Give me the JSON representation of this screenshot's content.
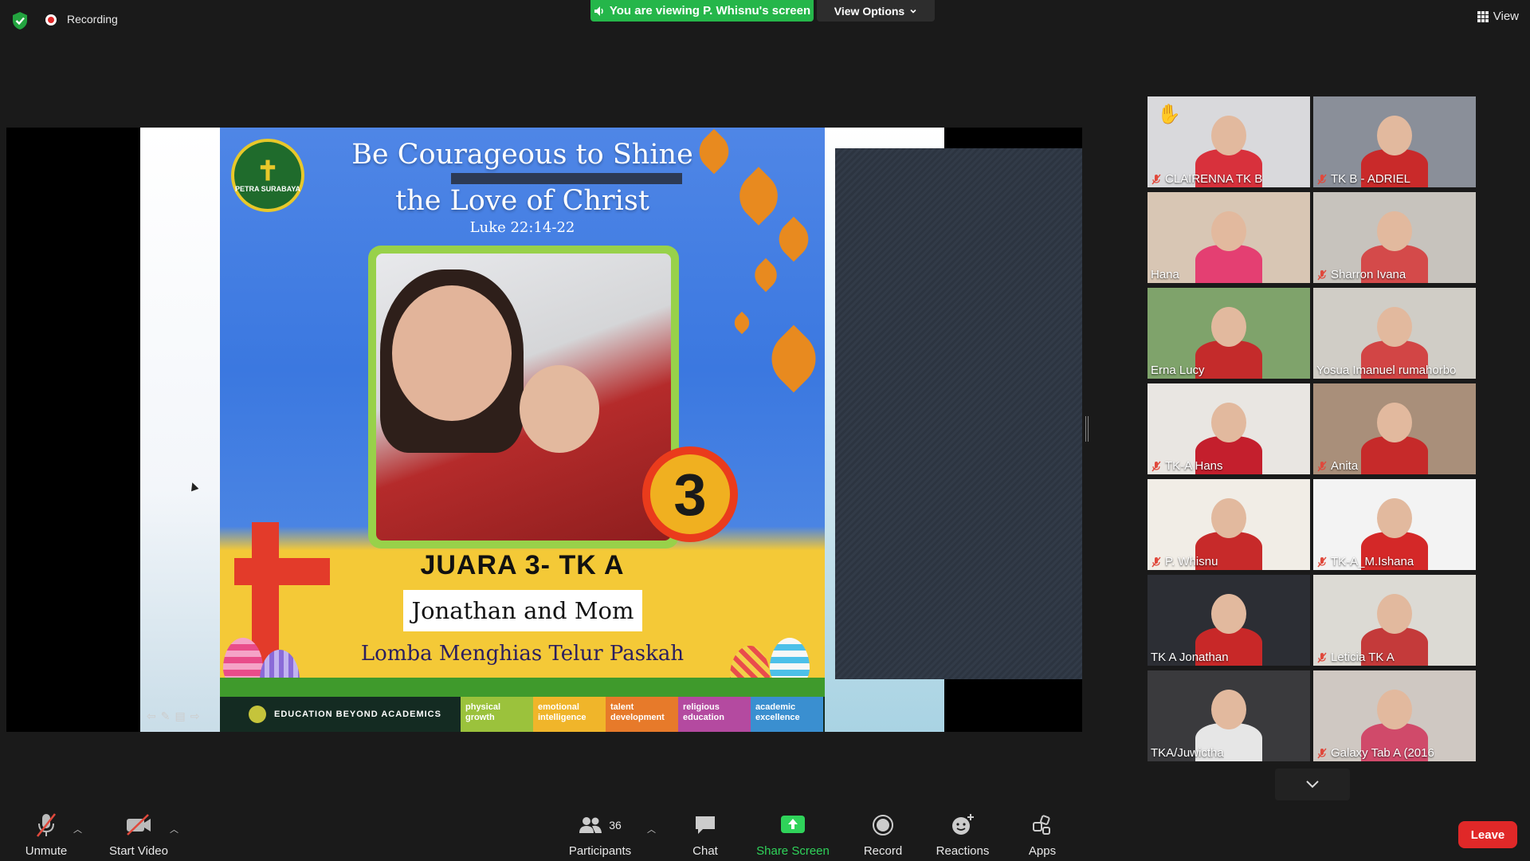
{
  "top": {
    "recording_label": "Recording",
    "viewing_banner": "You are viewing P. Whisnu's screen",
    "view_options_label": "View Options",
    "view_label": "View"
  },
  "slide": {
    "title_line1": "Be Courageous to Shine",
    "title_line2": "the Love of Christ",
    "verse": "Luke 22:14-22",
    "place_number": "3",
    "award": "JUARA 3- TK A",
    "winner": "Jonathan and Mom",
    "contest": "Lomba Menghias Telur Paskah",
    "footer_tagline": "EDUCATION BEYOND ACADEMICS",
    "logo_text": "PETRA SURABAYA",
    "pills": [
      {
        "l1": "physical",
        "l2": "growth",
        "color": "#9bc23c"
      },
      {
        "l1": "emotional",
        "l2": "intelligence",
        "color": "#f0b52a"
      },
      {
        "l1": "talent",
        "l2": "development",
        "color": "#e77a2a"
      },
      {
        "l1": "religious",
        "l2": "education",
        "color": "#b44aa0"
      },
      {
        "l1": "academic",
        "l2": "excellence",
        "color": "#3a8fd0"
      }
    ]
  },
  "participants": [
    {
      "name": "CLAIRENNA TK B",
      "muted": true,
      "hand": true,
      "bg": "#d9d9dc",
      "shirt": "#d8313c"
    },
    {
      "name": "TK B - ADRIEL",
      "muted": true,
      "hand": false,
      "bg": "#8a8f99",
      "shirt": "#c92a2a"
    },
    {
      "name": "Hana",
      "muted": false,
      "hand": false,
      "bg": "#d8c6b4",
      "shirt": "#e43f72"
    },
    {
      "name": "Sharron Ivana",
      "muted": true,
      "hand": false,
      "bg": "#c7c3bd",
      "shirt": "#d44a4a"
    },
    {
      "name": "Erna Lucy",
      "muted": false,
      "hand": false,
      "bg": "#7fa36b",
      "shirt": "#c42b2b"
    },
    {
      "name": "Yosua Imanuel rumahorbo",
      "muted": false,
      "hand": false,
      "bg": "#d0cdc6",
      "shirt": "#d24545"
    },
    {
      "name": "TK-A Hans",
      "muted": true,
      "hand": false,
      "bg": "#e9e6e2",
      "shirt": "#c41f2d"
    },
    {
      "name": "Anita",
      "muted": true,
      "hand": false,
      "bg": "#a98f7a",
      "shirt": "#c62a2a"
    },
    {
      "name": "P. Whisnu",
      "muted": true,
      "hand": false,
      "bg": "#f1ede6",
      "shirt": "#c72a2a"
    },
    {
      "name": "TK-A_M.Ishana",
      "muted": true,
      "hand": false,
      "bg": "#f3f3f3",
      "shirt": "#d42828"
    },
    {
      "name": "TK A Jonathan",
      "muted": false,
      "hand": false,
      "bg": "#2c2e34",
      "shirt": "#c82828"
    },
    {
      "name": "Leticia TK A",
      "muted": true,
      "hand": false,
      "bg": "#dcdad4",
      "shirt": "#c43a3a"
    },
    {
      "name": "TKA/Juwictha",
      "muted": false,
      "hand": false,
      "bg": "#3a3a3d",
      "shirt": "#e6e6e6",
      "active": true
    },
    {
      "name": "Galaxy Tab A (2016",
      "muted": true,
      "hand": false,
      "bg": "#cfc8c2",
      "shirt": "#d04a6a"
    }
  ],
  "toolbar": {
    "unmute": "Unmute",
    "start_video": "Start Video",
    "participants": "Participants",
    "participant_count": "36",
    "chat": "Chat",
    "share_screen": "Share Screen",
    "record": "Record",
    "reactions": "Reactions",
    "apps": "Apps",
    "leave": "Leave"
  },
  "colors": {
    "banner_green": "#25b64a",
    "leave_red": "#e02828",
    "active_speaker": "#c9e53a",
    "muted_red": "#e0493c"
  }
}
